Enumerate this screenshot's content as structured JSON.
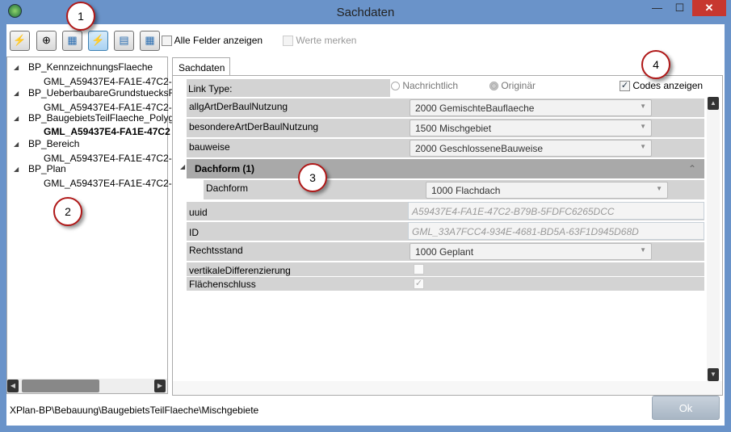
{
  "window": {
    "title": "Sachdaten",
    "minimize": "—",
    "maximize": "☐",
    "close": "✕"
  },
  "toolbar": {
    "buttons": [
      "lightning",
      "zoom",
      "copy-table",
      "lightning-star",
      "table-search",
      "paste-table"
    ],
    "alle_felder_label": "Alle Felder anzeigen",
    "werte_merken_label": "Werte merken"
  },
  "tree": {
    "items": [
      {
        "label": "BP_KennzeichnungsFlaeche",
        "child": "GML_A59437E4-FA1E-47C2-"
      },
      {
        "label": "BP_UeberbaubareGrundstuecksF",
        "child": "GML_A59437E4-FA1E-47C2-"
      },
      {
        "label": "BP_BaugebietsTeilFlaeche_Polyg",
        "child": "GML_A59437E4-FA1E-47C2"
      },
      {
        "label": "BP_Bereich",
        "child": "GML_A59437E4-FA1E-47C2-"
      },
      {
        "label": "BP_Plan",
        "child": "GML_A59437E4-FA1E-47C2-"
      }
    ]
  },
  "tab": {
    "label": "Sachdaten"
  },
  "form": {
    "link_type_label": "Link Type:",
    "radio1": "Nachrichtlich",
    "radio2": "Originär",
    "codes_label": "Codes anzeigen",
    "allg_label": "allgArtDerBaulNutzung",
    "allg_value": "2000  GemischteBauflaeche",
    "besondere_label": "besondereArtDerBaulNutzung",
    "besondere_value": "1500  Mischgebiet",
    "bauweise_label": "bauweise",
    "bauweise_value": "2000  GeschlosseneBauweise",
    "dachform_group": "Dachform (1)",
    "dachform_label": "Dachform",
    "dachform_value": "1000  Flachdach",
    "uuid_label": "uuid",
    "uuid_value": "A59437E4-FA1E-47C2-B79B-5FDFC6265DCC",
    "id_label": "ID",
    "id_value": "GML_33A7FCC4-934E-4681-BD5A-63F1D945D68D",
    "rechtsstand_label": "Rechtsstand",
    "rechtsstand_value": "1000  Geplant",
    "vertikal_label": "vertikaleDifferenzierung",
    "flaechen_label": "Flächenschluss"
  },
  "status": {
    "path": "XPlan-BP\\Bebauung\\BaugebietsTeilFlaeche\\Mischgebiete",
    "ok_label": "Ok"
  },
  "callouts": [
    "1",
    "2",
    "3",
    "4"
  ]
}
